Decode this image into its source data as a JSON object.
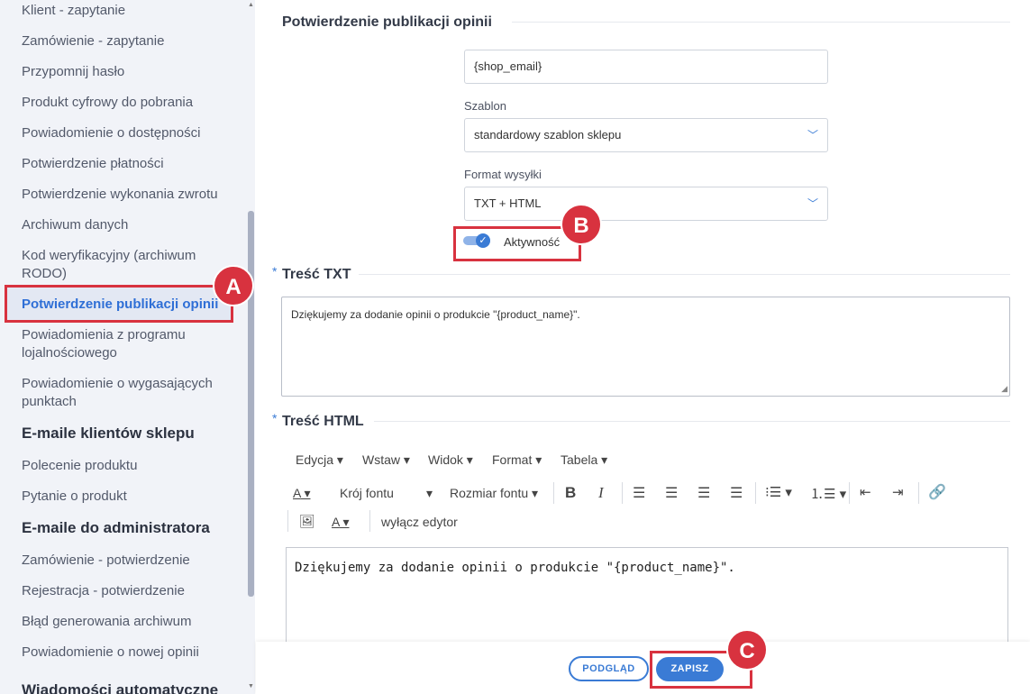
{
  "sidebar": {
    "items": [
      {
        "label": "Klient - zapytanie"
      },
      {
        "label": "Zamówienie - zapytanie"
      },
      {
        "label": "Przypomnij hasło"
      },
      {
        "label": "Produkt cyfrowy do pobrania"
      },
      {
        "label": "Powiadomienie o dostępności"
      },
      {
        "label": "Potwierdzenie płatności"
      },
      {
        "label": "Potwierdzenie wykonania zwrotu"
      },
      {
        "label": "Archiwum danych"
      },
      {
        "label": "Kod weryfikacyjny (archiwum RODO)"
      },
      {
        "label": "Potwierdzenie publikacji opinii"
      },
      {
        "label": "Powiadomienia z programu lojalnościowego"
      },
      {
        "label": "Powiadomienie o wygasających punktach"
      }
    ],
    "group2_title": "E-maile klientów sklepu",
    "group2_items": [
      {
        "label": "Polecenie produktu"
      },
      {
        "label": "Pytanie o produkt"
      }
    ],
    "group3_title": "E-maile do administratora",
    "group3_items": [
      {
        "label": "Zamówienie - potwierdzenie"
      },
      {
        "label": "Rejestracja - potwierdzenie"
      },
      {
        "label": "Błąd generowania archiwum"
      },
      {
        "label": "Powiadomienie o nowej opinii"
      }
    ],
    "group4_title": "Wiadomości automatyczne"
  },
  "main": {
    "section_title": "Potwierdzenie publikacji opinii",
    "sender_value": "{shop_email}",
    "template_label": "Szablon",
    "template_value": "standardowy szablon sklepu",
    "format_label": "Format wysyłki",
    "format_value": "TXT + HTML",
    "active_label": "Aktywność",
    "txt_title": "Treść TXT",
    "txt_content": "Dziękujemy za dodanie opinii o produkcie \"{product_name}\".",
    "html_title": "Treść HTML",
    "required_mark": "*",
    "editor": {
      "menu": [
        "Edycja",
        "Wstaw",
        "Widok",
        "Format",
        "Tabela"
      ],
      "font_family": "Krój fontu",
      "font_size": "Rozmiar fontu",
      "disable_editor": "wyłącz edytor",
      "text_color_glyph": "A",
      "content": "Dziękujemy za dodanie opinii o produkcie \"{product_name}\"."
    }
  },
  "footer": {
    "preview_label": "PODGLĄD",
    "save_label": "ZAPISZ"
  },
  "annotations": {
    "a": "A",
    "b": "B",
    "c": "C"
  },
  "colors": {
    "accent": "#3a7bd5",
    "marker": "#d8323f",
    "sidebar_bg": "#f1f3f8"
  }
}
